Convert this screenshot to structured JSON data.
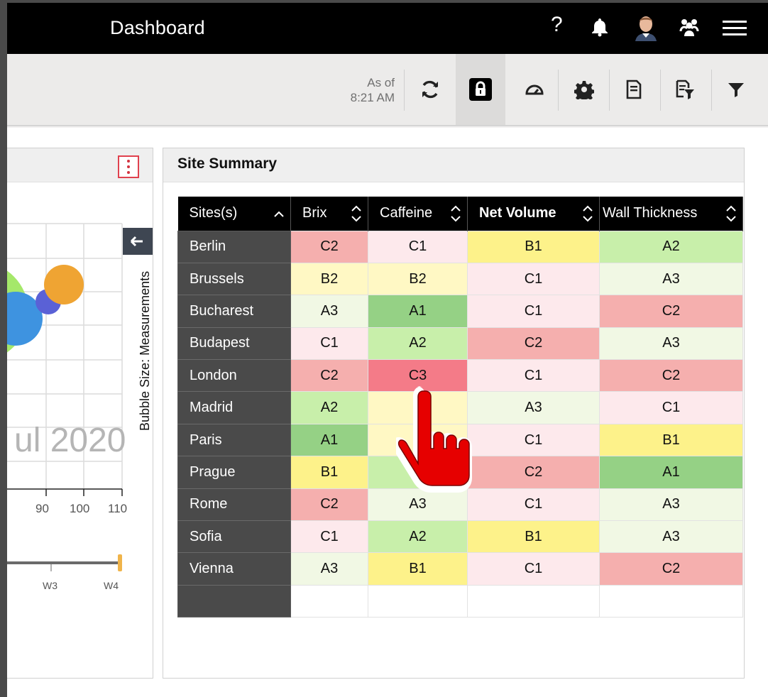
{
  "header": {
    "title": "Dashboard",
    "help_label": "?"
  },
  "toolbar": {
    "asof_line1": "As of",
    "asof_line2": "8:21 AM"
  },
  "left_panel": {
    "watermark": "ul 2020",
    "axis_ticks": [
      "90",
      "100",
      "110"
    ],
    "timeline_ticks": [
      "W3",
      "W4"
    ],
    "side_label": "Bubble Size: Measurements"
  },
  "site_summary": {
    "title": "Site Summary",
    "columns": [
      "Sites(s)",
      "Brix",
      "Caffeine",
      "Net Volume",
      "Wall Thickness"
    ],
    "rows": [
      {
        "site": "Berlin",
        "values": [
          "C2",
          "C1",
          "B1",
          "A2"
        ]
      },
      {
        "site": "Brussels",
        "values": [
          "B2",
          "B2",
          "C1",
          "A3"
        ]
      },
      {
        "site": "Bucharest",
        "values": [
          "A3",
          "A1",
          "C1",
          "C2"
        ]
      },
      {
        "site": "Budapest",
        "values": [
          "C1",
          "A2",
          "C2",
          "A3"
        ]
      },
      {
        "site": "London",
        "values": [
          "C2",
          "C3",
          "C1",
          "C2"
        ]
      },
      {
        "site": "Madrid",
        "values": [
          "A2",
          "",
          "A3",
          "C1"
        ]
      },
      {
        "site": "Paris",
        "values": [
          "A1",
          "",
          "C1",
          "B1"
        ]
      },
      {
        "site": "Prague",
        "values": [
          "B1",
          "",
          "C2",
          "A1"
        ]
      },
      {
        "site": "Rome",
        "values": [
          "C2",
          "A3",
          "C1",
          "A3"
        ]
      },
      {
        "site": "Sofia",
        "values": [
          "C1",
          "A2",
          "B1",
          "A3"
        ]
      },
      {
        "site": "Vienna",
        "values": [
          "A3",
          "B1",
          "C1",
          "C2"
        ]
      }
    ]
  },
  "colors": {
    "A1": "#95d185",
    "A2": "#c8efaa",
    "A3": "#f1f8e4",
    "B1": "#fdf28a",
    "B2": "#fff8c4",
    "C1": "#fde9ec",
    "C2": "#f5afae",
    "C3": "#f47b88"
  }
}
